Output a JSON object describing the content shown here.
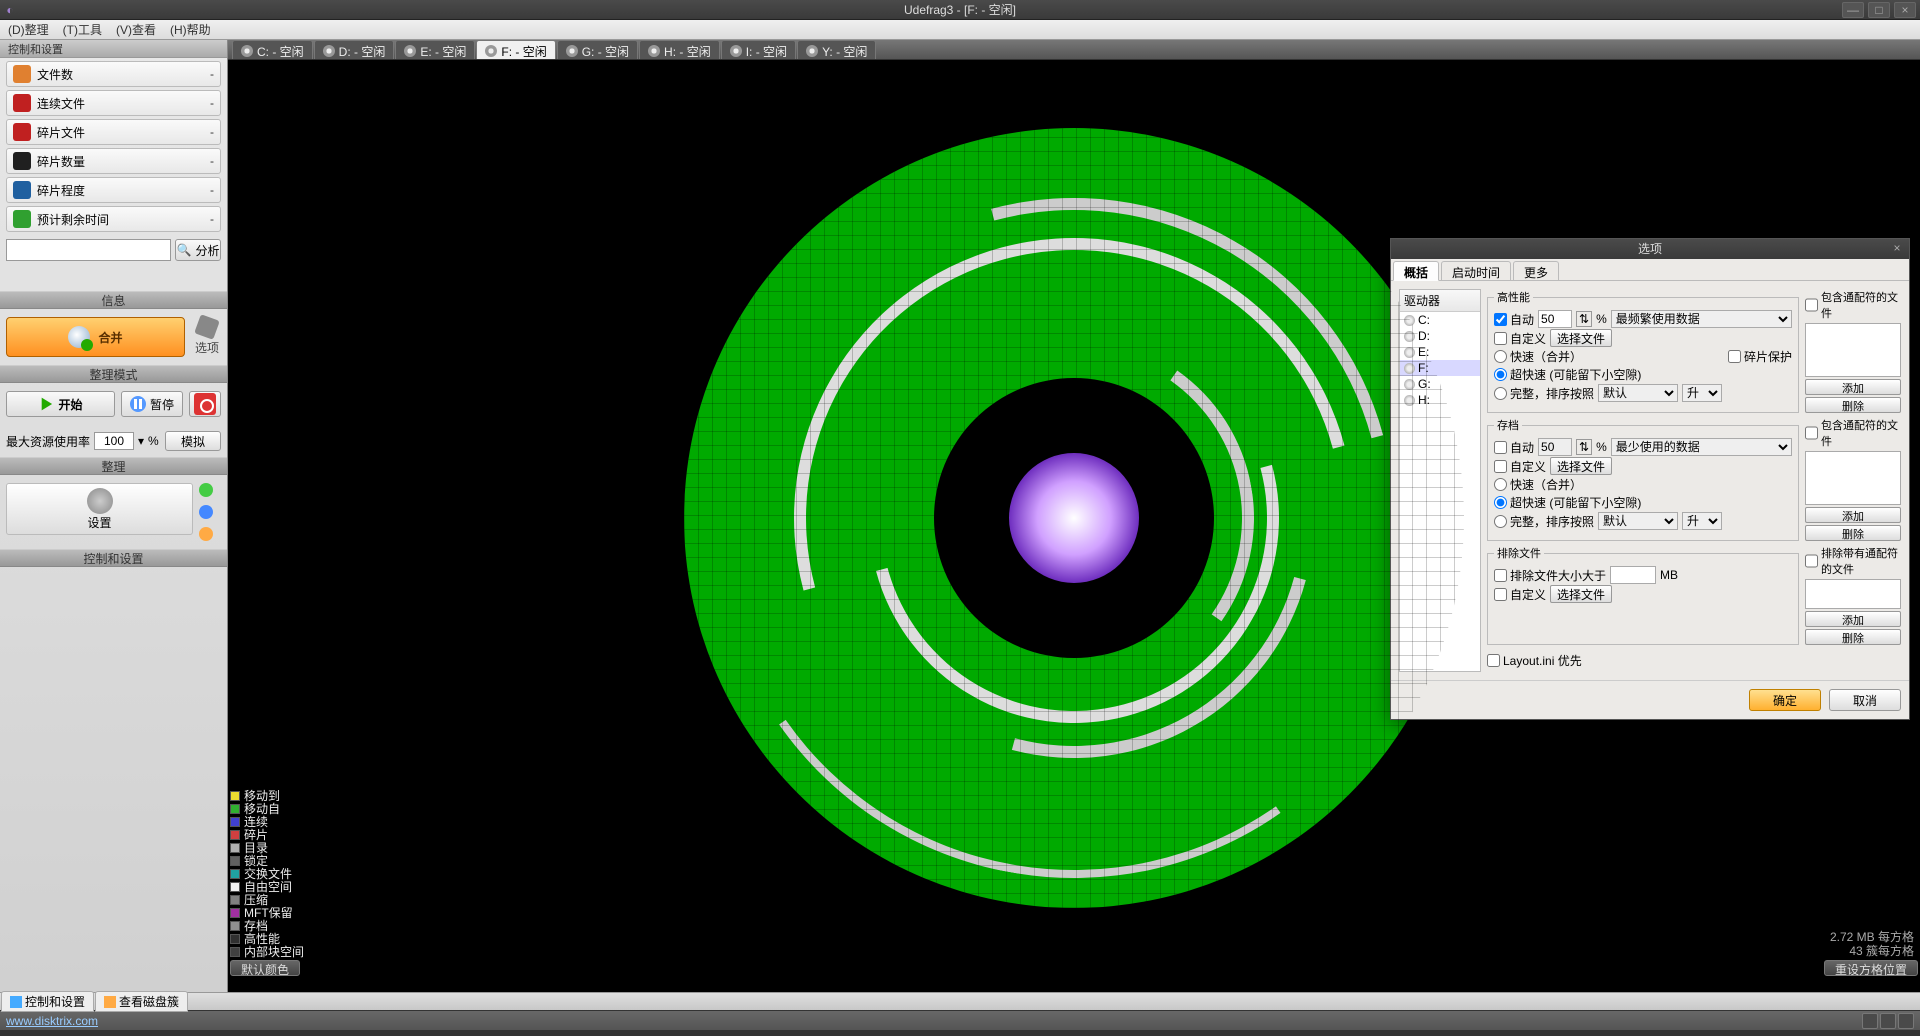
{
  "window": {
    "title": "Udefrag3 - [F: - 空闲]"
  },
  "menus": [
    "(D)整理",
    "(T)工具",
    "(V)查看",
    "(H)帮助"
  ],
  "side": {
    "header": "控制和设置",
    "stats": [
      {
        "icon": "#e08030",
        "label": "文件数",
        "value": "-"
      },
      {
        "icon": "#c02020",
        "label": "连续文件",
        "value": "-"
      },
      {
        "icon": "#c02020",
        "label": "碎片文件",
        "value": "-"
      },
      {
        "icon": "#202020",
        "label": "碎片数量",
        "value": "-"
      },
      {
        "icon": "#2060a0",
        "label": "碎片程度",
        "value": "-"
      },
      {
        "icon": "#30a030",
        "label": "预计剩余时间",
        "value": "-"
      }
    ],
    "analyze": "分析",
    "info_hdr": "信息",
    "merge": "合并",
    "options": "选项",
    "mode_hdr": "整理模式",
    "start": "开始",
    "pause": "暂停",
    "res_label": "最大资源使用率",
    "res_val": "100",
    "res_unit": "%",
    "simulate": "模拟",
    "arrange_hdr": "整理",
    "settings": "设置",
    "ctrl_hdr": "控制和设置"
  },
  "tabs": [
    {
      "label": "C: - 空闲"
    },
    {
      "label": "D: - 空闲"
    },
    {
      "label": "E: - 空闲"
    },
    {
      "label": "F: - 空闲",
      "active": true
    },
    {
      "label": "G: - 空闲"
    },
    {
      "label": "H: - 空闲"
    },
    {
      "label": "I: - 空闲"
    },
    {
      "label": "Y: - 空闲"
    }
  ],
  "legend": [
    {
      "c": "#eedd30",
      "t": "移动到"
    },
    {
      "c": "#30b030",
      "t": "移动自"
    },
    {
      "c": "#4040d0",
      "t": "连续"
    },
    {
      "c": "#d04040",
      "t": "碎片"
    },
    {
      "c": "#b0b0b0",
      "t": "目录"
    },
    {
      "c": "#606060",
      "t": "锁定"
    },
    {
      "c": "#20a0a0",
      "t": "交换文件"
    },
    {
      "c": "#f0f0f0",
      "t": "自由空间"
    },
    {
      "c": "#808080",
      "t": "压缩"
    },
    {
      "c": "#a030a0",
      "t": "MFT保留"
    },
    {
      "c": "#909090",
      "t": "存档"
    },
    {
      "c": "#303030",
      "t": "高性能"
    },
    {
      "c": "#404040",
      "t": "内部块空间"
    }
  ],
  "viewinfo": {
    "l1": "2.72 MB 每方格",
    "l2": "43 簇每方格"
  },
  "colorbtn": "默认颜色",
  "resetbtn": "重设方格位置",
  "dlg": {
    "title": "选项",
    "tabs": [
      "概括",
      "启动时间",
      "更多"
    ],
    "drivers_hdr": "驱动器",
    "drivers": [
      "C:",
      "D:",
      "E:",
      "F:",
      "G:",
      "H:"
    ],
    "hp_title": "高性能",
    "auto": "自动",
    "autoval": "50",
    "autounit": "%",
    "autosort": "最频繁使用数据",
    "custom": "自定义",
    "choose": "选择文件",
    "fast": "快速（合并）",
    "fragprotect": "碎片保护",
    "superfast": "超快速 (可能留下小空隙)",
    "full": "完整，排序按照",
    "fullsel": "默认",
    "dir": "升",
    "arc_title": "存档",
    "arcsort": "最少使用的数据",
    "ex_title": "排除文件",
    "ex_size": "排除文件大小大于",
    "mb": "MB",
    "wild1": "包含通配符的文件",
    "wild2": "排除带有通配符的文件",
    "add": "添加",
    "del": "删除",
    "layout": "Layout.ini 优先",
    "ok": "确定",
    "cancel": "取消"
  },
  "bottom_tabs": [
    "控制和设置",
    "查看磁盘簇"
  ],
  "status_link": "www.disktrix.com"
}
